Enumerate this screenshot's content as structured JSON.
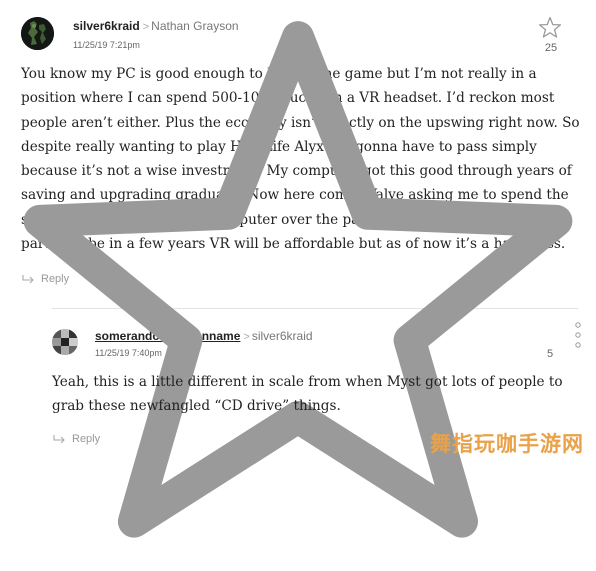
{
  "comments": [
    {
      "author": "silver6kraid",
      "reply_to": "Nathan Grayson",
      "timestamp": "11/25/19 7:21pm",
      "stars": "25",
      "body": "You know my PC is good enough to handle the game but I’m not really in a position where I can spend 500-1000 bucks on a VR headset. I’d reckon most people aren’t either. Plus the economy isn’t exactly on the upswing right now. So despite really wanting to play Half-Life Alyx I’m gonna have to pass simply because it’s not a wise investment. My computer got this good through years of saving and upgrading gradually. Now here comes Valve asking me to spend the same amount I put into my computer over the past 2 years on a single required part. Maybe in a few years VR will be affordable but as of now it’s a hard pass.",
      "reply_label": "Reply"
    },
    {
      "author": "somerandomscreenname",
      "reply_to": "silver6kraid",
      "timestamp": "11/25/19 7:40pm",
      "stars": "5",
      "body": "Yeah, this is a little different in scale from when Myst got lots of people to grab these newfangled “CD drive” things.",
      "reply_label": "Reply"
    }
  ],
  "icons": {
    "star": "star-outline-icon",
    "reply": "reply-arrow-icon",
    "more": "kebab-menu-icon"
  },
  "watermark": "舞指玩咖手游网"
}
